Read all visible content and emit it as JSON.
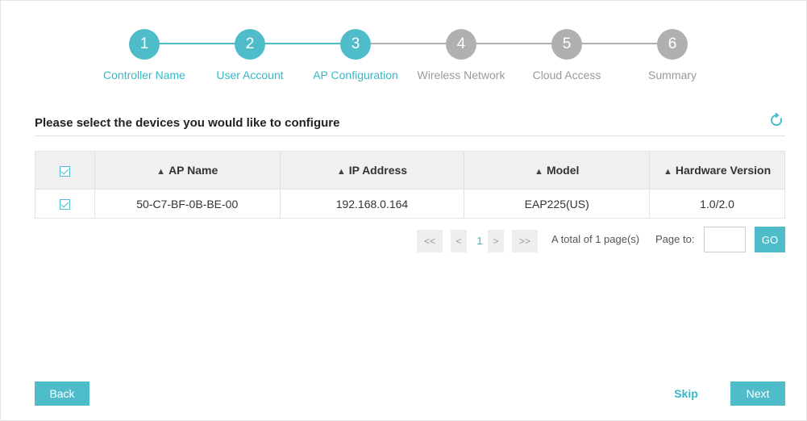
{
  "wizard": {
    "steps": [
      {
        "number": "1",
        "label": "Controller Name",
        "state": "active"
      },
      {
        "number": "2",
        "label": "User Account",
        "state": "active"
      },
      {
        "number": "3",
        "label": "AP Configuration",
        "state": "active"
      },
      {
        "number": "4",
        "label": "Wireless Network",
        "state": "inactive"
      },
      {
        "number": "5",
        "label": "Cloud Access",
        "state": "inactive"
      },
      {
        "number": "6",
        "label": "Summary",
        "state": "inactive"
      }
    ],
    "active_color": "#4fbcc9",
    "inactive_color": "#b0b0b0",
    "inactive_label_color": "#999999"
  },
  "section": {
    "title": "Please select the devices you would like to configure",
    "refresh_icon": "refresh-icon"
  },
  "table": {
    "columns": [
      "AP Name",
      "IP Address",
      "Model",
      "Hardware Version"
    ],
    "sort_glyph": "⬍",
    "select_all_checked": true,
    "rows": [
      {
        "checked": true,
        "ap_name": "50-C7-BF-0B-BE-00",
        "ip": "192.168.0.164",
        "model": "EAP225(US)",
        "hw": "1.0/2.0"
      }
    ]
  },
  "pagination": {
    "first": "<<",
    "prev": "<",
    "current_page": "1",
    "next": ">",
    "last": ">>",
    "total_text": "A total of 1 page(s)",
    "page_to_label": "Page to:",
    "page_input_value": "",
    "go_label": "GO"
  },
  "footer": {
    "back_label": "Back",
    "skip_label": "Skip",
    "next_label": "Next"
  }
}
